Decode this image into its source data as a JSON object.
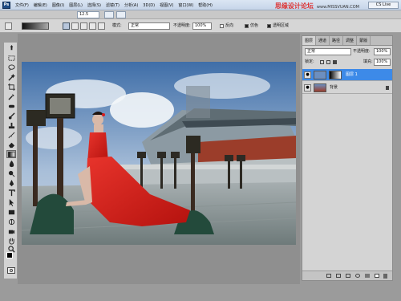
{
  "app": {
    "logo": "Ps",
    "zoom": "12.5",
    "cs_live": "CS Live"
  },
  "watermark": {
    "text": "思缘设计论坛",
    "sub": "www.MISSVUAN.COM"
  },
  "menu": [
    "文件(F)",
    "编辑(E)",
    "图像(I)",
    "图层(L)",
    "选择(S)",
    "滤镜(T)",
    "分析(A)",
    "3D(D)",
    "视图(V)",
    "窗口(W)",
    "帮助(H)"
  ],
  "options": {
    "mode_label": "模式:",
    "mode_value": "正常",
    "opacity_label": "不透明度:",
    "opacity_value": "100%",
    "reverse_label": "反向",
    "dither_label": "仿色",
    "transparency_label": "透明区域"
  },
  "layers_panel": {
    "tabs": [
      "图层",
      "通道",
      "路径",
      "调整",
      "蒙版"
    ],
    "blend_mode": "正常",
    "opacity_label": "不透明度:",
    "opacity_value": "100%",
    "lock_label": "锁定:",
    "fill_label": "填充:",
    "fill_value": "100%",
    "layers": [
      {
        "name": "图层 1",
        "selected": true
      },
      {
        "name": "背景",
        "selected": false
      }
    ]
  },
  "colors": {
    "accent": "#3d8ae8",
    "dress": "#d81e1e",
    "sky": "#6c8fc0"
  },
  "icons": [
    "marquee-icon",
    "move-icon",
    "lasso-icon",
    "magic-wand-icon",
    "crop-icon",
    "eyedropper-icon",
    "healing-icon",
    "brush-icon",
    "stamp-icon",
    "history-brush-icon",
    "eraser-icon",
    "gradient-icon",
    "blur-icon",
    "dodge-icon",
    "pen-icon",
    "text-icon",
    "path-select-icon",
    "shape-icon",
    "3d-rotate-icon",
    "3d-camera-icon",
    "hand-icon",
    "zoom-icon"
  ]
}
